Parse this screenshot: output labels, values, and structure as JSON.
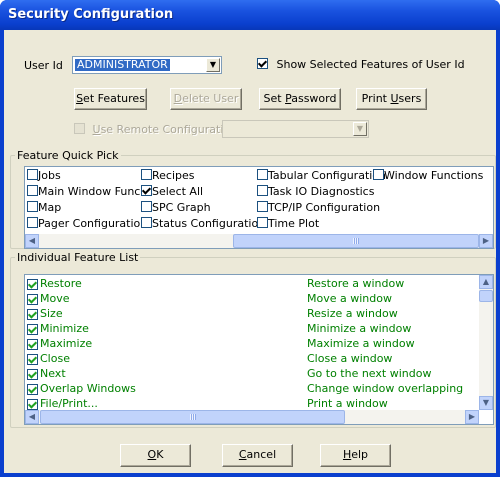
{
  "window": {
    "title": "Security Configuration"
  },
  "user": {
    "label": "User Id",
    "selected": "ADMINISTRATOR",
    "show_selected_label": "Show Selected Features of User Id",
    "show_selected_checked": true
  },
  "buttons": {
    "set_features": {
      "underline": "S",
      "rest": "et Features"
    },
    "delete_user": {
      "before": "",
      "underline": "D",
      "rest": "elete User"
    },
    "set_password": {
      "before": "Set ",
      "underline": "P",
      "rest": "assword"
    },
    "print_users": {
      "before": "Print ",
      "underline": "U",
      "rest": "sers"
    }
  },
  "remote": {
    "label_underline": "U",
    "label_rest": "se Remote Configuration",
    "checked": false,
    "value": ""
  },
  "quick_pick": {
    "title": "Feature Quick Pick",
    "items": [
      {
        "label": "Jobs",
        "checked": false
      },
      {
        "label": "Main Window Functions",
        "checked": false
      },
      {
        "label": "Map",
        "checked": false
      },
      {
        "label": "Pager Configuration",
        "checked": false
      },
      {
        "label": "Recipes",
        "checked": false
      },
      {
        "label": "Select All",
        "checked": true
      },
      {
        "label": "SPC Graph",
        "checked": false
      },
      {
        "label": "Status Configuration",
        "checked": false
      },
      {
        "label": "Tabular Configuration",
        "checked": false
      },
      {
        "label": "Task IO Diagnostics",
        "checked": false
      },
      {
        "label": "TCP/IP Configuration",
        "checked": false
      },
      {
        "label": "Time Plot",
        "checked": false
      },
      {
        "label": "Window Functions",
        "checked": false
      }
    ]
  },
  "feature_list": {
    "title": "Individual Feature List",
    "rows": [
      {
        "name": "Restore",
        "desc": "Restore a window",
        "checked": true
      },
      {
        "name": "Move",
        "desc": "Move a window",
        "checked": true
      },
      {
        "name": "Size",
        "desc": "Resize a window",
        "checked": true
      },
      {
        "name": "Minimize",
        "desc": "Minimize a window",
        "checked": true
      },
      {
        "name": "Maximize",
        "desc": "Maximize a window",
        "checked": true
      },
      {
        "name": "Close",
        "desc": "Close a window",
        "checked": true
      },
      {
        "name": "Next",
        "desc": "Go to the next window",
        "checked": true
      },
      {
        "name": "Overlap Windows",
        "desc": "Change window overlapping",
        "checked": true
      },
      {
        "name": "File/Print...",
        "desc": "Print a window",
        "checked": true
      }
    ]
  },
  "dialog_buttons": {
    "ok": {
      "underline": "O",
      "rest": "K"
    },
    "cancel": {
      "underline": "C",
      "rest": "ancel"
    },
    "help": {
      "underline": "H",
      "rest": "elp"
    }
  }
}
